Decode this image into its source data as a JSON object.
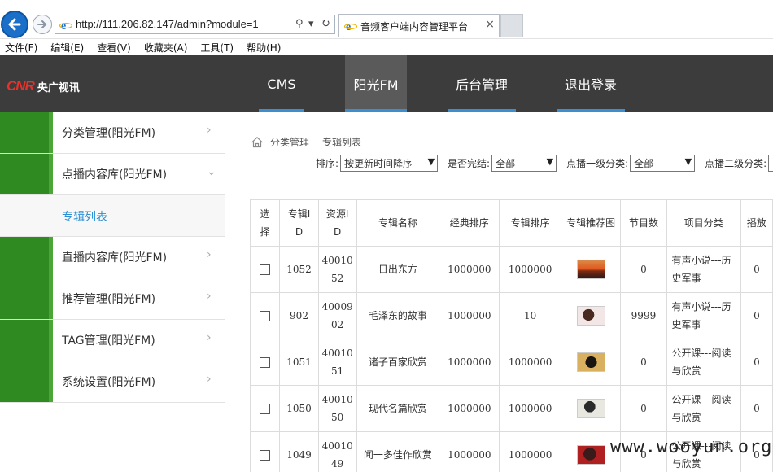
{
  "browser": {
    "url": "http://111.206.82.147/admin?module=1",
    "tab_title": "音频客户端内容管理平台",
    "tab_close": "×",
    "search_glyph": "⚲",
    "dropdown_glyph": "▾",
    "refresh_glyph": "↻",
    "menu": [
      "文件(F)",
      "编辑(E)",
      "查看(V)",
      "收藏夹(A)",
      "工具(T)",
      "帮助(H)"
    ]
  },
  "header": {
    "logo_mark": "CNR",
    "logo_text": "央广视讯",
    "nav": [
      "CMS",
      "阳光FM",
      "后台管理",
      "退出登录"
    ],
    "active_nav": "阳光FM",
    "accent_color": "#3b8fd0"
  },
  "sidebar": {
    "items": [
      {
        "label": "分类管理(阳光FM)",
        "chevron": "›"
      },
      {
        "label": "点播内容库(阳光FM)",
        "chevron": "⌄"
      },
      {
        "label": "专辑列表"
      },
      {
        "label": "直播内容库(阳光FM)",
        "chevron": "›"
      },
      {
        "label": "推荐管理(阳光FM)",
        "chevron": "›"
      },
      {
        "label": "TAG管理(阳光FM)",
        "chevron": "›"
      },
      {
        "label": "系统设置(阳光FM)",
        "chevron": "›"
      }
    ],
    "green_color": "#2f8a22"
  },
  "breadcrumb": {
    "level1": "分类管理",
    "level2": "专辑列表"
  },
  "filters": {
    "sort_label": "排序:",
    "sort_value": "按更新时间降序",
    "finished_label": "是否完结:",
    "finished_value": "全部",
    "cat1_label": "点播一级分类:",
    "cat1_value": "全部",
    "cat2_label": "点播二级分类:",
    "arrow": "▼"
  },
  "table": {
    "headers": {
      "select": [
        "选",
        "择"
      ],
      "album_id": [
        "专辑I",
        "D"
      ],
      "resource_id": [
        "资源I",
        "D"
      ],
      "name": "专辑名称",
      "classic_order": "经典排序",
      "album_order": "专辑排序",
      "image": "专辑推荐图",
      "episodes": "节目数",
      "category": "项目分类",
      "play": "播放"
    },
    "rows": [
      {
        "album_id": "1052",
        "resource_id": [
          "40010",
          "52"
        ],
        "name": "日出东方",
        "classic": "1000000",
        "order": "1000000",
        "image": "sunrise-thumbnail",
        "episodes": "0",
        "category": [
          "有声小说---历",
          "史军事"
        ],
        "play": "0"
      },
      {
        "album_id": "902",
        "resource_id": [
          "40009",
          "02"
        ],
        "name": "毛泽东的故事",
        "classic": "1000000",
        "order": "10",
        "image": "portrait-thumbnail",
        "episodes": "9999",
        "category": [
          "有声小说---历",
          "史军事"
        ],
        "play": "0"
      },
      {
        "album_id": "1051",
        "resource_id": [
          "40010",
          "51"
        ],
        "name": "诸子百家欣赏",
        "classic": "1000000",
        "order": "1000000",
        "image": "philosophy-thumbnail",
        "episodes": "0",
        "category": [
          "公开课---阅读",
          "与欣赏"
        ],
        "play": "0"
      },
      {
        "album_id": "1050",
        "resource_id": [
          "40010",
          "50"
        ],
        "name": "现代名篇欣赏",
        "classic": "1000000",
        "order": "1000000",
        "image": "author-thumbnail",
        "episodes": "0",
        "category": [
          "公开课---阅读",
          "与欣赏"
        ],
        "play": "0"
      },
      {
        "album_id": "1049",
        "resource_id": [
          "40010",
          "49"
        ],
        "name": "闻一多佳作欣赏",
        "classic": "1000000",
        "order": "1000000",
        "image": "poet-thumbnail",
        "episodes": "0",
        "category": [
          "公开课---阅读",
          "与欣赏"
        ],
        "play": "0"
      }
    ]
  },
  "watermark": "www.wooyun.org"
}
